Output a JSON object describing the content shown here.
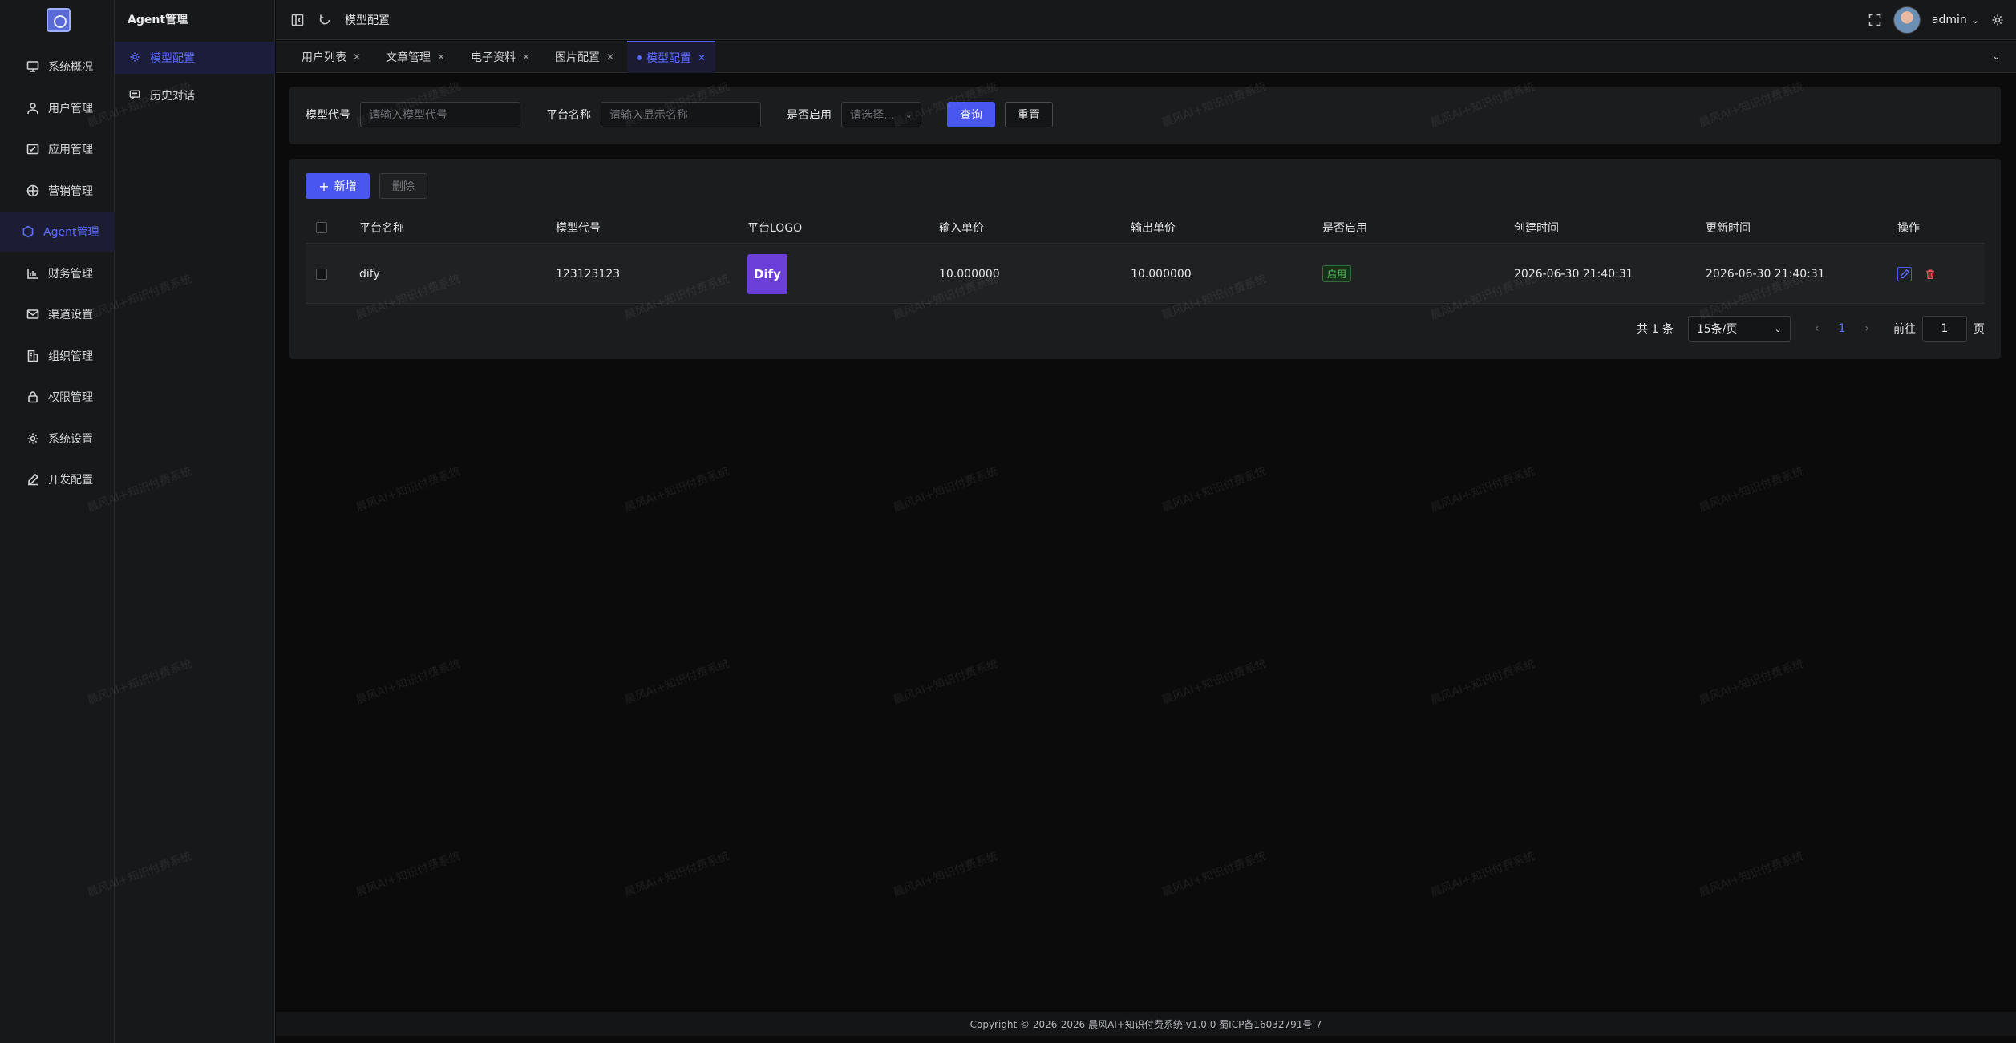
{
  "rail": {
    "items": [
      {
        "label": "系统概况",
        "icon": "monitor-icon"
      },
      {
        "label": "用户管理",
        "icon": "user-icon"
      },
      {
        "label": "应用管理",
        "icon": "app-icon"
      },
      {
        "label": "营销管理",
        "icon": "marketing-icon"
      },
      {
        "label": "Agent管理",
        "icon": "agent-icon",
        "active": true
      },
      {
        "label": "财务管理",
        "icon": "finance-icon"
      },
      {
        "label": "渠道设置",
        "icon": "mail-icon"
      },
      {
        "label": "组织管理",
        "icon": "building-icon"
      },
      {
        "label": "权限管理",
        "icon": "lock-icon"
      },
      {
        "label": "系统设置",
        "icon": "gear-icon"
      },
      {
        "label": "开发配置",
        "icon": "code-icon"
      }
    ]
  },
  "submenu": {
    "title": "Agent管理",
    "items": [
      {
        "label": "模型配置",
        "icon": "gear-icon",
        "active": true
      },
      {
        "label": "历史对话",
        "icon": "chat-icon"
      }
    ]
  },
  "topbar": {
    "breadcrumb": "模型配置",
    "username": "admin"
  },
  "tabs": [
    {
      "label": "用户列表"
    },
    {
      "label": "文章管理"
    },
    {
      "label": "电子资料"
    },
    {
      "label": "图片配置"
    },
    {
      "label": "模型配置",
      "active": true
    }
  ],
  "search": {
    "model_code_label": "模型代号",
    "model_code_placeholder": "请输入模型代号",
    "platform_label": "平台名称",
    "platform_placeholder": "请输入显示名称",
    "enabled_label": "是否启用",
    "enabled_placeholder": "请选择...",
    "query_button": "查询",
    "reset_button": "重置"
  },
  "toolbar": {
    "add_button": "新增",
    "delete_button": "删除"
  },
  "table": {
    "columns": [
      "平台名称",
      "模型代号",
      "平台LOGO",
      "输入单价",
      "输出单价",
      "是否启用",
      "创建时间",
      "更新时间",
      "操作"
    ],
    "rows": [
      {
        "platform": "dify",
        "model_code": "123123123",
        "logo_text": "Dify",
        "input_price": "10.000000",
        "output_price": "10.000000",
        "enabled": "启用",
        "created": "2026-06-30 21:40:31",
        "updated": "2026-06-30 21:40:31"
      }
    ]
  },
  "pager": {
    "total": "共 1 条",
    "page_size": "15条/页",
    "current_page": "1",
    "goto_label": "前往",
    "goto_value": "1",
    "page_suffix": "页"
  },
  "footer": {
    "copyright": "Copyright © 2026-2026 晨风AI+知识付费系统 v1.0.0   蜀ICP备16032791号-7"
  },
  "watermark": "晨风AI+知识付费系统",
  "colors": {
    "accent": "#4a56f0",
    "active_text": "#5b6cff",
    "success": "#5fbf63",
    "danger": "#e05555"
  }
}
